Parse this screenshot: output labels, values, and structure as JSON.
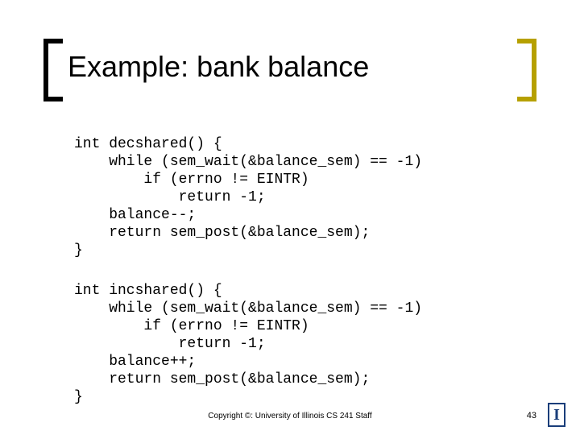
{
  "slide": {
    "title": "Example: bank balance",
    "code1": "int decshared() {\n    while (sem_wait(&balance_sem) == -1)\n        if (errno != EINTR)\n            return -1;\n    balance--;\n    return sem_post(&balance_sem);\n}",
    "code2": "int incshared() {\n    while (sem_wait(&balance_sem) == -1)\n        if (errno != EINTR)\n            return -1;\n    balance++;\n    return sem_post(&balance_sem);\n}",
    "footer": "Copyright ©: University of Illinois CS 241 Staff",
    "page_number": "43",
    "logo_letter": "I"
  }
}
